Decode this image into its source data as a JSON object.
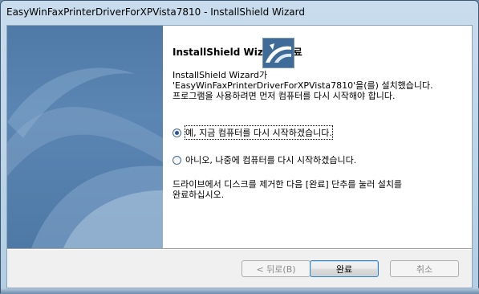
{
  "window": {
    "title": "EasyWinFaxPrinterDriverForXPVista7810 - InstallShield Wizard"
  },
  "content": {
    "heading": "InstallShield Wizard 완료",
    "message_line1": "InstallShield Wizard가",
    "message_line2": "'EasyWinFaxPrinterDriverForXPVista7810'을(를) 설치했습니다.",
    "message_line3": "프로그램을 사용하려면 먼저 컴퓨터를 다시 시작해야 합니다.",
    "options": [
      {
        "label": "예, 지금 컴퓨터를 다시 시작하겠습니다.",
        "selected": true
      },
      {
        "label": "아니오, 나중에 컴퓨터를 다시 시작하겠습니다.",
        "selected": false
      }
    ],
    "note_line1": "드라이브에서 디스크를 제거한 다음 [완료] 단추를 눌러 설치를",
    "note_line2": "완료하십시오."
  },
  "buttons": {
    "back": "< 뒤로(B)",
    "finish": "완료",
    "cancel": "취소"
  },
  "icons": {
    "logo": "installshield-logo-icon"
  }
}
